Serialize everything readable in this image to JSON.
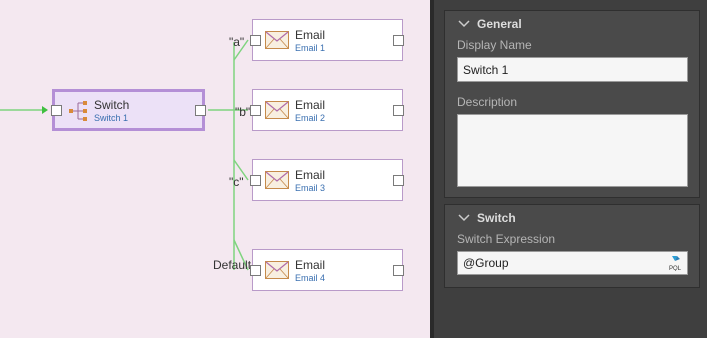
{
  "canvas": {
    "switch_node": {
      "title": "Switch",
      "subtitle": "Switch 1"
    },
    "email_nodes": [
      {
        "title": "Email",
        "subtitle": "Email 1",
        "branch": "\"a\""
      },
      {
        "title": "Email",
        "subtitle": "Email 2",
        "branch": "\"b\""
      },
      {
        "title": "Email",
        "subtitle": "Email 3",
        "branch": "\"c\""
      },
      {
        "title": "Email",
        "subtitle": "Email 4",
        "branch": "Default"
      }
    ]
  },
  "panel": {
    "general": {
      "title": "General",
      "display_name_label": "Display Name",
      "display_name_value": "Switch 1",
      "description_label": "Description",
      "description_value": ""
    },
    "switch": {
      "title": "Switch",
      "expression_label": "Switch Expression",
      "expression_value": "@Group",
      "expression_icon": "pql-icon"
    }
  },
  "colors": {
    "canvas_bg": "#f4e8f0",
    "wire": "#7fd47f",
    "switch_border": "#b48fd6",
    "panel_bg": "#3f3f3f"
  }
}
